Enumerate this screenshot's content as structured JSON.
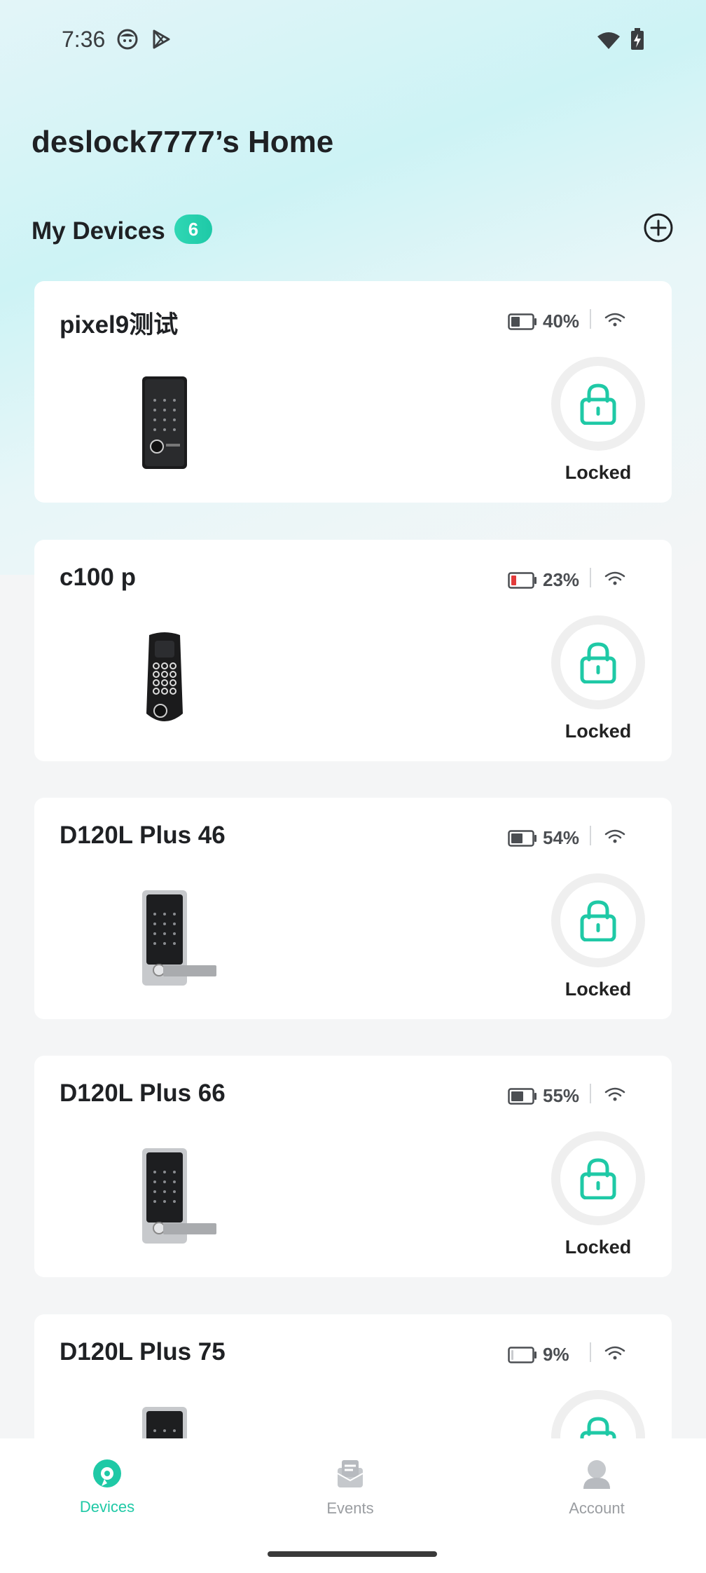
{
  "status_bar": {
    "time": "7:36"
  },
  "header": {
    "home_title": "deslock7777’s Home"
  },
  "section": {
    "title": "My Devices",
    "count": "6"
  },
  "devices": [
    {
      "name": "pixel9测试",
      "battery_pct": "40%",
      "battery_level": 0.4,
      "battery_color": "#4b4e52",
      "status": "Locked",
      "model_type": "keypad-fingerprint"
    },
    {
      "name": "c100 p",
      "battery_pct": "23%",
      "battery_level": 0.23,
      "battery_color": "#e23b3b",
      "status": "Locked",
      "model_type": "keypad-round"
    },
    {
      "name": "D120L Plus 46",
      "battery_pct": "54%",
      "battery_level": 0.54,
      "battery_color": "#4b4e52",
      "status": "Locked",
      "model_type": "lever"
    },
    {
      "name": "D120L Plus 66",
      "battery_pct": "55%",
      "battery_level": 0.55,
      "battery_color": "#4b4e52",
      "status": "Locked",
      "model_type": "lever"
    },
    {
      "name": "D120L Plus 75",
      "battery_pct": "9%",
      "battery_level": 0.09,
      "battery_color": "#c9cbce",
      "status": "Locked",
      "model_type": "lever"
    }
  ],
  "bottom_nav": [
    {
      "label": "Devices",
      "active": true,
      "icon": "devices-icon"
    },
    {
      "label": "Events",
      "active": false,
      "icon": "events-icon"
    },
    {
      "label": "Account",
      "active": false,
      "icon": "account-icon"
    }
  ],
  "colors": {
    "accent": "#1fc9a6",
    "badge": "#2fd7b4",
    "battery_low": "#e23b3b"
  }
}
